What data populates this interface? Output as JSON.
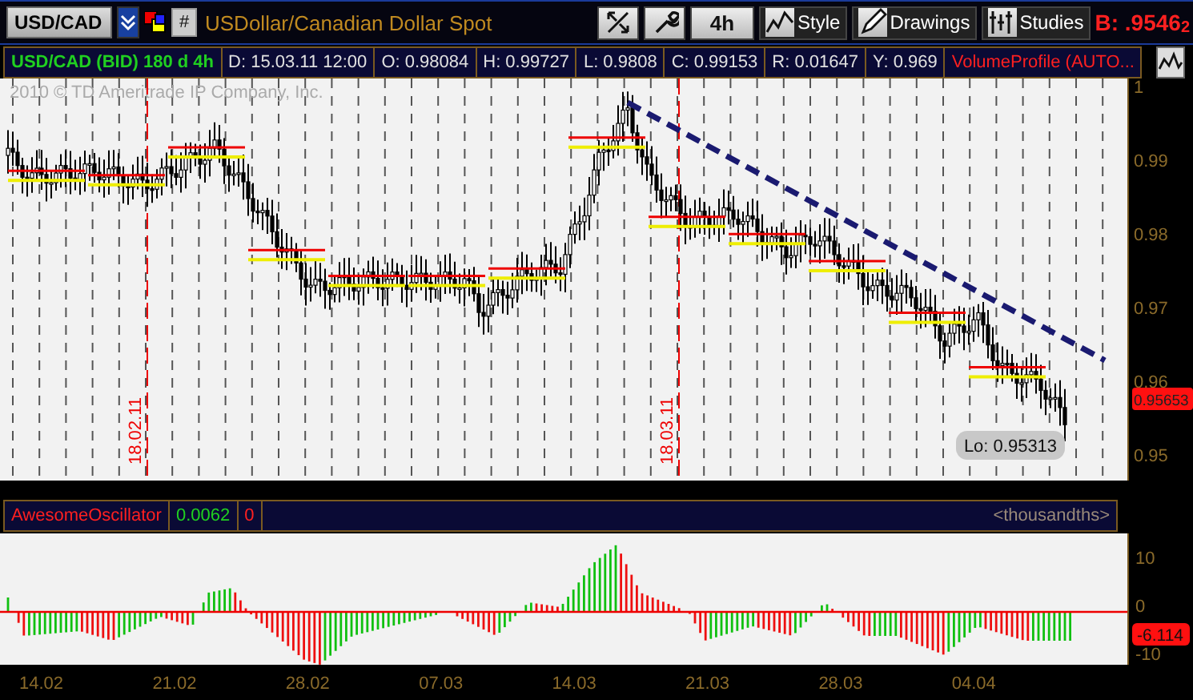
{
  "toolbar": {
    "symbol": "USD/CAD",
    "grid_button": "#",
    "description": "USDollar/Canadian Dollar Spot",
    "aggregation": "4h",
    "buttons": [
      "Style",
      "Drawings",
      "Studies"
    ],
    "bid": "B: .9546$_{2}$"
  },
  "info_bar": {
    "fields": [
      {
        "kind": "title",
        "text": "USD/CAD (BID) 180 d 4h"
      },
      {
        "kind": "value",
        "text": "D: 15.03.11 12:00"
      },
      {
        "kind": "value",
        "text": "O: 0.98084"
      },
      {
        "kind": "value",
        "text": "H: 0.99727"
      },
      {
        "kind": "value",
        "text": "L: 0.9808"
      },
      {
        "kind": "value",
        "text": "C: 0.99153"
      },
      {
        "kind": "value",
        "text": "R: 0.01647"
      },
      {
        "kind": "value",
        "text": "Y: 0.969"
      },
      {
        "kind": "study",
        "text": "VolumeProfile (AUTO..."
      }
    ]
  },
  "price_chart": {
    "copyright": "2010 © TD Ameritrade IP Company, Inc.",
    "date_markers": [
      "18.02.11",
      "18.03.11"
    ],
    "y_labels": [
      "1",
      "0.99",
      "0.98",
      "0.97",
      "0.96",
      "0.95"
    ],
    "last_price": "0.95653",
    "low_label": "Lo: 0.95313"
  },
  "oscillator": {
    "header_fields": [
      {
        "text": "AwesomeOscillator",
        "kind": "name"
      },
      {
        "text": "0.0062",
        "kind": "rise"
      },
      {
        "text": "0",
        "kind": "fall"
      }
    ],
    "units": "<thousandths>",
    "y_labels": [
      "10",
      "0",
      "-10"
    ],
    "last_value": "-6.114"
  },
  "x_axis": {
    "labels": [
      "14.02",
      "21.02",
      "28.02",
      "07.03",
      "14.03",
      "21.03",
      "28.03",
      "04.04"
    ]
  }
}
